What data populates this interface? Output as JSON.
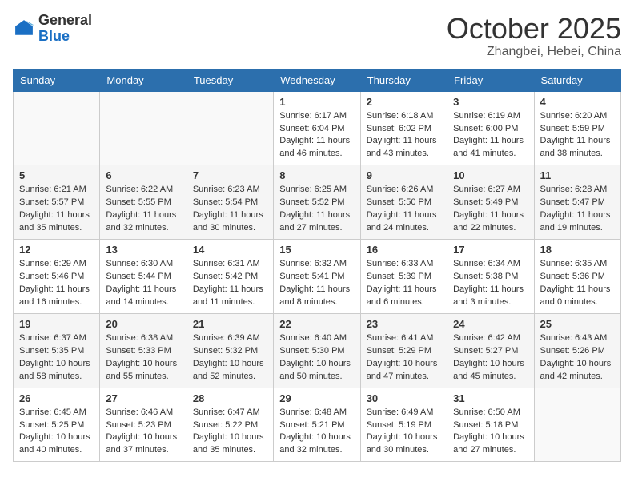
{
  "header": {
    "logo_general": "General",
    "logo_blue": "Blue",
    "month_title": "October 2025",
    "location": "Zhangbei, Hebei, China"
  },
  "days_of_week": [
    "Sunday",
    "Monday",
    "Tuesday",
    "Wednesday",
    "Thursday",
    "Friday",
    "Saturday"
  ],
  "weeks": [
    [
      {
        "day": "",
        "content": ""
      },
      {
        "day": "",
        "content": ""
      },
      {
        "day": "",
        "content": ""
      },
      {
        "day": "1",
        "content": "Sunrise: 6:17 AM\nSunset: 6:04 PM\nDaylight: 11 hours and 46 minutes."
      },
      {
        "day": "2",
        "content": "Sunrise: 6:18 AM\nSunset: 6:02 PM\nDaylight: 11 hours and 43 minutes."
      },
      {
        "day": "3",
        "content": "Sunrise: 6:19 AM\nSunset: 6:00 PM\nDaylight: 11 hours and 41 minutes."
      },
      {
        "day": "4",
        "content": "Sunrise: 6:20 AM\nSunset: 5:59 PM\nDaylight: 11 hours and 38 minutes."
      }
    ],
    [
      {
        "day": "5",
        "content": "Sunrise: 6:21 AM\nSunset: 5:57 PM\nDaylight: 11 hours and 35 minutes."
      },
      {
        "day": "6",
        "content": "Sunrise: 6:22 AM\nSunset: 5:55 PM\nDaylight: 11 hours and 32 minutes."
      },
      {
        "day": "7",
        "content": "Sunrise: 6:23 AM\nSunset: 5:54 PM\nDaylight: 11 hours and 30 minutes."
      },
      {
        "day": "8",
        "content": "Sunrise: 6:25 AM\nSunset: 5:52 PM\nDaylight: 11 hours and 27 minutes."
      },
      {
        "day": "9",
        "content": "Sunrise: 6:26 AM\nSunset: 5:50 PM\nDaylight: 11 hours and 24 minutes."
      },
      {
        "day": "10",
        "content": "Sunrise: 6:27 AM\nSunset: 5:49 PM\nDaylight: 11 hours and 22 minutes."
      },
      {
        "day": "11",
        "content": "Sunrise: 6:28 AM\nSunset: 5:47 PM\nDaylight: 11 hours and 19 minutes."
      }
    ],
    [
      {
        "day": "12",
        "content": "Sunrise: 6:29 AM\nSunset: 5:46 PM\nDaylight: 11 hours and 16 minutes."
      },
      {
        "day": "13",
        "content": "Sunrise: 6:30 AM\nSunset: 5:44 PM\nDaylight: 11 hours and 14 minutes."
      },
      {
        "day": "14",
        "content": "Sunrise: 6:31 AM\nSunset: 5:42 PM\nDaylight: 11 hours and 11 minutes."
      },
      {
        "day": "15",
        "content": "Sunrise: 6:32 AM\nSunset: 5:41 PM\nDaylight: 11 hours and 8 minutes."
      },
      {
        "day": "16",
        "content": "Sunrise: 6:33 AM\nSunset: 5:39 PM\nDaylight: 11 hours and 6 minutes."
      },
      {
        "day": "17",
        "content": "Sunrise: 6:34 AM\nSunset: 5:38 PM\nDaylight: 11 hours and 3 minutes."
      },
      {
        "day": "18",
        "content": "Sunrise: 6:35 AM\nSunset: 5:36 PM\nDaylight: 11 hours and 0 minutes."
      }
    ],
    [
      {
        "day": "19",
        "content": "Sunrise: 6:37 AM\nSunset: 5:35 PM\nDaylight: 10 hours and 58 minutes."
      },
      {
        "day": "20",
        "content": "Sunrise: 6:38 AM\nSunset: 5:33 PM\nDaylight: 10 hours and 55 minutes."
      },
      {
        "day": "21",
        "content": "Sunrise: 6:39 AM\nSunset: 5:32 PM\nDaylight: 10 hours and 52 minutes."
      },
      {
        "day": "22",
        "content": "Sunrise: 6:40 AM\nSunset: 5:30 PM\nDaylight: 10 hours and 50 minutes."
      },
      {
        "day": "23",
        "content": "Sunrise: 6:41 AM\nSunset: 5:29 PM\nDaylight: 10 hours and 47 minutes."
      },
      {
        "day": "24",
        "content": "Sunrise: 6:42 AM\nSunset: 5:27 PM\nDaylight: 10 hours and 45 minutes."
      },
      {
        "day": "25",
        "content": "Sunrise: 6:43 AM\nSunset: 5:26 PM\nDaylight: 10 hours and 42 minutes."
      }
    ],
    [
      {
        "day": "26",
        "content": "Sunrise: 6:45 AM\nSunset: 5:25 PM\nDaylight: 10 hours and 40 minutes."
      },
      {
        "day": "27",
        "content": "Sunrise: 6:46 AM\nSunset: 5:23 PM\nDaylight: 10 hours and 37 minutes."
      },
      {
        "day": "28",
        "content": "Sunrise: 6:47 AM\nSunset: 5:22 PM\nDaylight: 10 hours and 35 minutes."
      },
      {
        "day": "29",
        "content": "Sunrise: 6:48 AM\nSunset: 5:21 PM\nDaylight: 10 hours and 32 minutes."
      },
      {
        "day": "30",
        "content": "Sunrise: 6:49 AM\nSunset: 5:19 PM\nDaylight: 10 hours and 30 minutes."
      },
      {
        "day": "31",
        "content": "Sunrise: 6:50 AM\nSunset: 5:18 PM\nDaylight: 10 hours and 27 minutes."
      },
      {
        "day": "",
        "content": ""
      }
    ]
  ]
}
